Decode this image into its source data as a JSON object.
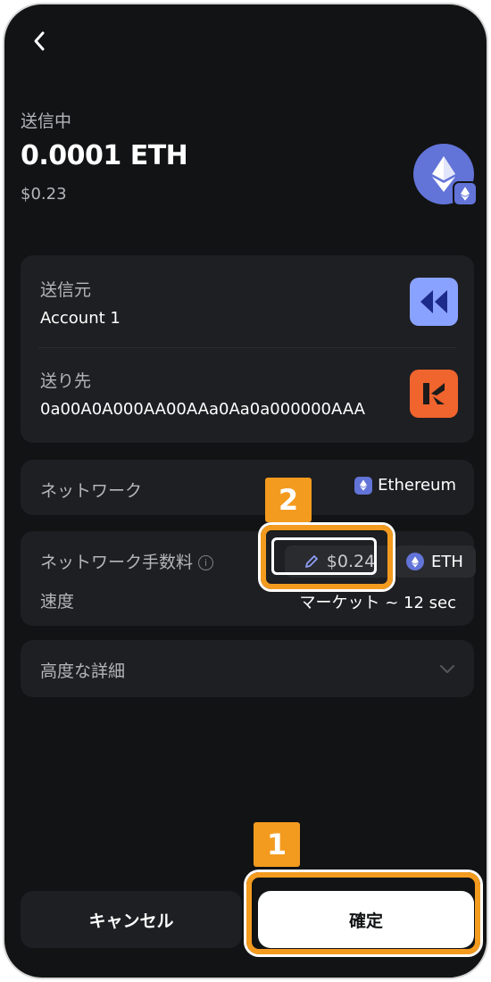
{
  "header": {
    "sending_label": "送信中",
    "amount": "0.0001 ETH",
    "amount_fiat": "$0.23"
  },
  "addresses": {
    "from_label": "送信元",
    "from_value": "Account 1",
    "to_label": "送り先",
    "to_value": "0a00A0A000AA00AAa0Aa0a000000AAA"
  },
  "network": {
    "label": "ネットワーク",
    "value": "Ethereum"
  },
  "fee": {
    "label": "ネットワーク手数料",
    "info_glyph": "i",
    "value": "$0.24",
    "token": "ETH",
    "speed_label": "速度",
    "speed_value": "マーケット ~ 12 sec"
  },
  "advanced": {
    "label": "高度な詳細"
  },
  "actions": {
    "cancel_label": "キャンセル",
    "confirm_label": "確定"
  },
  "annotations": {
    "badge_1": "1",
    "badge_2": "2"
  },
  "colors": {
    "background": "#121314",
    "card": "#1e1f22",
    "eth": "#6274d8",
    "highlight": "#f39b1f",
    "from_avatar": "#8aa2ff",
    "to_avatar": "#f0642e"
  },
  "icons": {
    "back": "chevron-left-icon",
    "token": "ethereum-icon",
    "edit": "pencil-icon",
    "expand": "chevron-down-icon"
  }
}
